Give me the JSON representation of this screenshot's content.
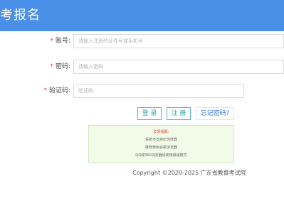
{
  "header": {
    "title": "考报名",
    "color": "#4a8fe8"
  },
  "form": {
    "account": {
      "label": "账号:",
      "placeholder": "请输入注册的证件号或手机号",
      "required_mark": "*"
    },
    "password": {
      "label": "密码:",
      "placeholder": "请输入密码",
      "required_mark": "*"
    },
    "captcha": {
      "label": "验证码:",
      "placeholder": "验证码",
      "required_mark": "*"
    }
  },
  "actions": {
    "login": "登 录",
    "register": "注 册",
    "forgot": "忘记密码?"
  },
  "tips": {
    "title": "友情提醒:",
    "lines": [
      "系统不支持IE浏览器",
      "推荐使用谷歌浏览器",
      "QQ或360浏览器请使用极速模式"
    ]
  },
  "footer": {
    "copyright": "Copyright ©2020-2025 广东省教育考试院"
  }
}
